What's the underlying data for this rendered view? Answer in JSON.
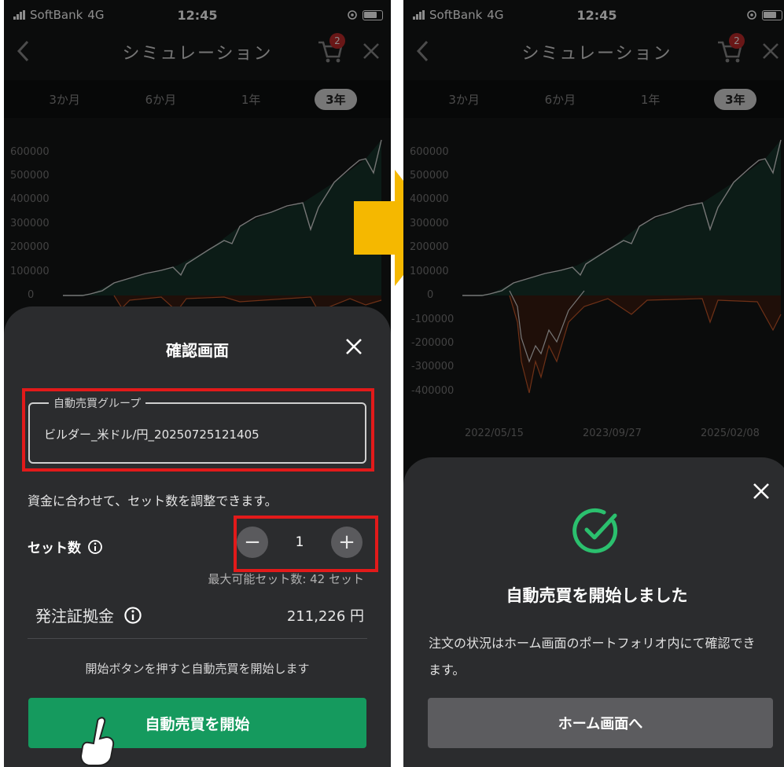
{
  "status_bar": {
    "carrier": "SoftBank",
    "network": "4G",
    "time": "12:45"
  },
  "nav": {
    "title": "シミュレーション",
    "cart_badge": "2"
  },
  "period_tabs": [
    {
      "label": "3か月",
      "active": false
    },
    {
      "label": "6か月",
      "active": false
    },
    {
      "label": "1年",
      "active": false
    },
    {
      "label": "3年",
      "active": true
    }
  ],
  "chart": {
    "y_ticks_left": [
      "600000",
      "500000",
      "400000",
      "300000",
      "200000",
      "100000",
      "0"
    ],
    "y_ticks_right": [
      "600000",
      "500000",
      "400000",
      "300000",
      "200000",
      "100000",
      "0",
      "-100000",
      "-200000",
      "-300000",
      "-400000"
    ],
    "x_ticks": [
      "2022/05/15",
      "2023/09/27",
      "2025/02/08"
    ],
    "colors": {
      "profit": "#d8d8d8",
      "drawdown": "#c85a2a",
      "fill": "#17342a"
    }
  },
  "confirm": {
    "title": "確認画面",
    "group_legend": "自動売買グループ",
    "group_value": "ビルダー_米ドル/円_20250725121405",
    "description": "資金に合わせて、セット数を調整できます。",
    "set_label": "セット数",
    "set_value": "1",
    "max_sets": "最大可能セット数: 42 セット",
    "margin_label": "発注証拠金",
    "margin_value": "211,226 円",
    "start_note": "開始ボタンを押すと自動売買を開始します",
    "start_button": "自動売買を開始"
  },
  "success": {
    "title": "自動売買を開始しました",
    "message": "注文の状況はホーム画面のポートフォリオ内にて確認できます。",
    "home_button": "ホーム画面へ"
  },
  "accent": {
    "green": "#159a5e",
    "highlight_red": "#e21a1a",
    "arrow_yellow": "#f5b800"
  }
}
